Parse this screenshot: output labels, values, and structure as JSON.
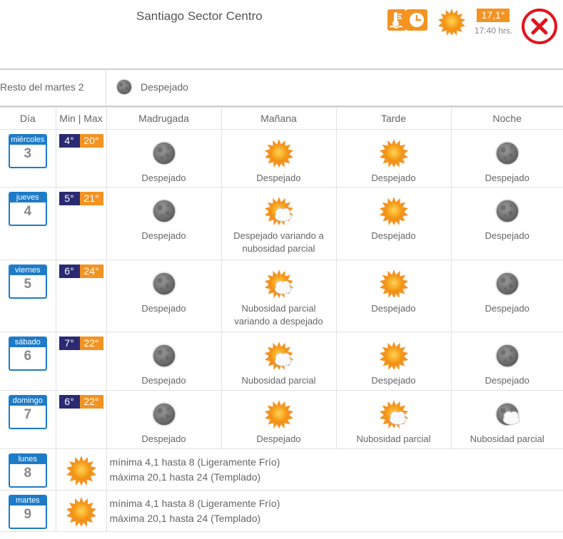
{
  "header": {
    "location": "Santiago Sector Centro",
    "current_temp": "17,1°",
    "time": "17:40 hrs."
  },
  "resto": {
    "label": "Resto del martes 2",
    "condition": "Despejado"
  },
  "columns": {
    "dia": "Día",
    "minmax": "Min | Max",
    "madrugada": "Madrugada",
    "manana": "Mañana",
    "tarde": "Tarde",
    "noche": "Noche"
  },
  "days": [
    {
      "name": "miércoles",
      "num": "3",
      "min": "4°",
      "max": "20°",
      "madrugada": "Despejado",
      "manana": "Despejado",
      "tarde": "Despejado",
      "noche": "Despejado"
    },
    {
      "name": "jueves",
      "num": "4",
      "min": "5°",
      "max": "21°",
      "madrugada": "Despejado",
      "manana": "Despejado variando a nubosidad parcial",
      "tarde": "Despejado",
      "noche": "Despejado"
    },
    {
      "name": "viernes",
      "num": "5",
      "min": "6°",
      "max": "24°",
      "madrugada": "Despejado",
      "manana": "Nubosidad parcial variando a despejado",
      "tarde": "Despejado",
      "noche": "Despejado"
    },
    {
      "name": "sábado",
      "num": "6",
      "min": "7°",
      "max": "22°",
      "madrugada": "Despejado",
      "manana": "Nubosidad parcial",
      "tarde": "Despejado",
      "noche": "Despejado"
    },
    {
      "name": "domingo",
      "num": "7",
      "min": "6°",
      "max": "22°",
      "madrugada": "Despejado",
      "manana": "Despejado",
      "tarde": "Nubosidad parcial",
      "noche": "Nubosidad parcial"
    }
  ],
  "extended": [
    {
      "name": "lunes",
      "num": "8",
      "line1": "mínima 4,1 hasta 8 (Ligeramente Frío)",
      "line2": "máxima 20,1 hasta 24 (Templado)"
    },
    {
      "name": "martes",
      "num": "9",
      "line1": "mínima 4,1 hasta 8 (Ligeramente Frío)",
      "line2": "máxima 20,1 hasta 24 (Templado)"
    }
  ],
  "icons": {
    "sun": "sun-icon",
    "moon": "moon-icon",
    "sun_cloud": "sun-cloud-icon",
    "moon_cloud": "moon-cloud-icon",
    "thermometer": "thermometer-icon",
    "clock": "clock-icon",
    "close": "close-icon"
  },
  "colors": {
    "accent_orange": "#f39322",
    "min_navy": "#2a2a72",
    "day_blue": "#1e7bc8",
    "close_red": "#e3121b"
  }
}
